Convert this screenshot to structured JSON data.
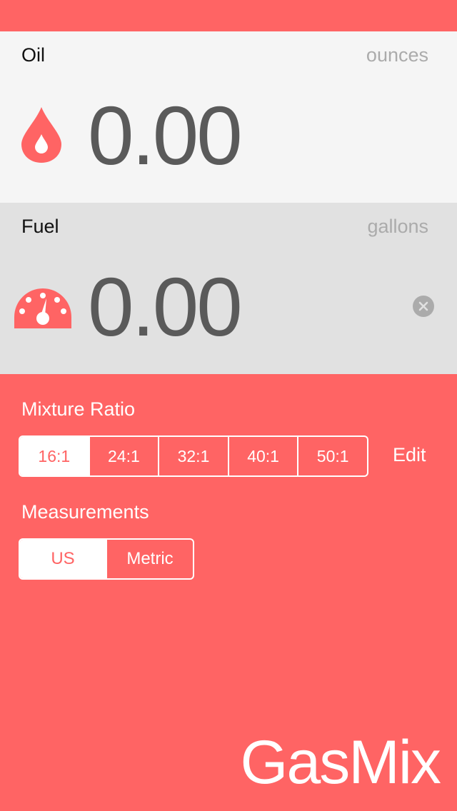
{
  "oil": {
    "label": "Oil",
    "unit": "ounces",
    "value": "0.00",
    "icon": "drop-icon"
  },
  "fuel": {
    "label": "Fuel",
    "unit": "gallons",
    "value": "0.00",
    "icon": "gauge-icon"
  },
  "mixture": {
    "title": "Mixture Ratio",
    "options": [
      "16:1",
      "24:1",
      "32:1",
      "40:1",
      "50:1"
    ],
    "selected": "16:1",
    "edit_label": "Edit"
  },
  "measurements": {
    "title": "Measurements",
    "options": [
      "US",
      "Metric"
    ],
    "selected": "US"
  },
  "brand": {
    "part1": "Gas",
    "part2": "Mix"
  },
  "colors": {
    "accent": "#FF6464",
    "oil_panel": "#F5F5F5",
    "fuel_panel": "#E1E1E1",
    "value_text": "#5A5A5A",
    "muted": "#ABABAB"
  }
}
